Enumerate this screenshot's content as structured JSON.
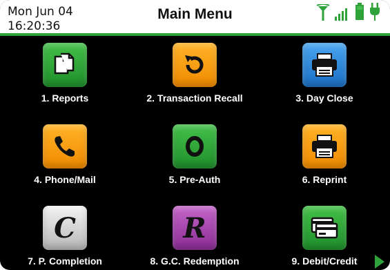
{
  "status": {
    "date": "Mon Jun 04",
    "time": "16:20:36",
    "title": "Main Menu",
    "icons": [
      "antenna-icon",
      "signal-bars-icon",
      "battery-icon",
      "power-plug-icon"
    ]
  },
  "menu": {
    "items": [
      {
        "label": "1. Reports",
        "icon": "reports-icon",
        "color": "#2e9f38"
      },
      {
        "label": "2. Transaction Recall",
        "icon": "recall-icon",
        "color": "#f7a11a"
      },
      {
        "label": "3. Day Close",
        "icon": "printer-icon",
        "color": "#2b86d8"
      },
      {
        "label": "4. Phone/Mail",
        "icon": "phone-icon",
        "color": "#f7a11a"
      },
      {
        "label": "5. Pre-Auth",
        "icon": "pre-auth-icon",
        "color": "#2e9f38"
      },
      {
        "label": "6. Reprint",
        "icon": "printer-icon",
        "color": "#f7a11a"
      },
      {
        "label": "7. P. Completion",
        "icon": "completion-c-icon",
        "color": "#d9d9d9"
      },
      {
        "label": "8. G.C. Redemption",
        "icon": "redemption-r-icon",
        "color": "#a845b0"
      },
      {
        "label": "9. Debit/Credit",
        "icon": "card-icon",
        "color": "#2e9f38"
      }
    ]
  },
  "colors": {
    "accent": "#2fa23a"
  }
}
